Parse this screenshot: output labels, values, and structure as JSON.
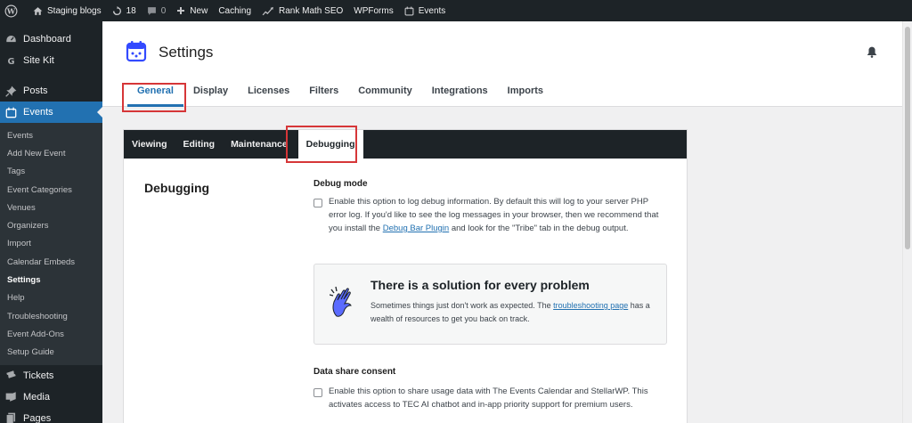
{
  "adminbar": {
    "site_name": "Staging blogs",
    "updates_count": "18",
    "comments_count": "0",
    "new_label": "New",
    "caching_label": "Caching",
    "rankmath_label": "Rank Math SEO",
    "wpforms_label": "WPForms",
    "events_label": "Events"
  },
  "sidebar": {
    "top_items": [
      {
        "label": "Dashboard",
        "icon": "dashboard-icon"
      },
      {
        "label": "Site Kit",
        "icon": "site-kit-icon"
      },
      {
        "label": "Posts",
        "icon": "pin-icon"
      },
      {
        "label": "Events",
        "icon": "calendar-icon"
      }
    ],
    "submenu": [
      "Events",
      "Add New Event",
      "Tags",
      "Event Categories",
      "Venues",
      "Organizers",
      "Import",
      "Calendar Embeds",
      "Settings",
      "Help",
      "Troubleshooting",
      "Event Add-Ons",
      "Setup Guide"
    ],
    "bottom_items": [
      {
        "label": "Tickets",
        "icon": "ticket-icon"
      },
      {
        "label": "Media",
        "icon": "media-icon"
      },
      {
        "label": "Pages",
        "icon": "pages-icon"
      }
    ]
  },
  "header": {
    "title": "Settings",
    "tabs": [
      "General",
      "Display",
      "Licenses",
      "Filters",
      "Community",
      "Integrations",
      "Imports"
    ],
    "active_tab": "General"
  },
  "panel": {
    "subtabs": [
      "Viewing",
      "Editing",
      "Maintenance",
      "Debugging"
    ],
    "active_subtab": "Debugging",
    "section_title": "Debugging",
    "debug_mode": {
      "title": "Debug mode",
      "desc_before_link": "Enable this option to log debug information. By default this will log to your server PHP error log. If you'd like to see the log messages in your browser, then we recommend that you install the ",
      "link": "Debug Bar Plugin",
      "desc_after_link": " and look for the \"Tribe\" tab in the debug output."
    },
    "callout": {
      "title": "There is a solution for every problem",
      "text_before_link": "Sometimes things just don't work as expected. The ",
      "link": "troubleshooting page",
      "text_after_link": " has a wealth of resources to get you back on track."
    },
    "data_share": {
      "title": "Data share consent",
      "desc": "Enable this option to share usage data with The Events Calendar and StellarWP. This activates access to TEC AI chatbot and in-app priority support for premium users."
    }
  },
  "colors": {
    "admin_dark": "#1d2327",
    "accent_blue": "#2271b1",
    "highlight_red": "#d63638"
  }
}
